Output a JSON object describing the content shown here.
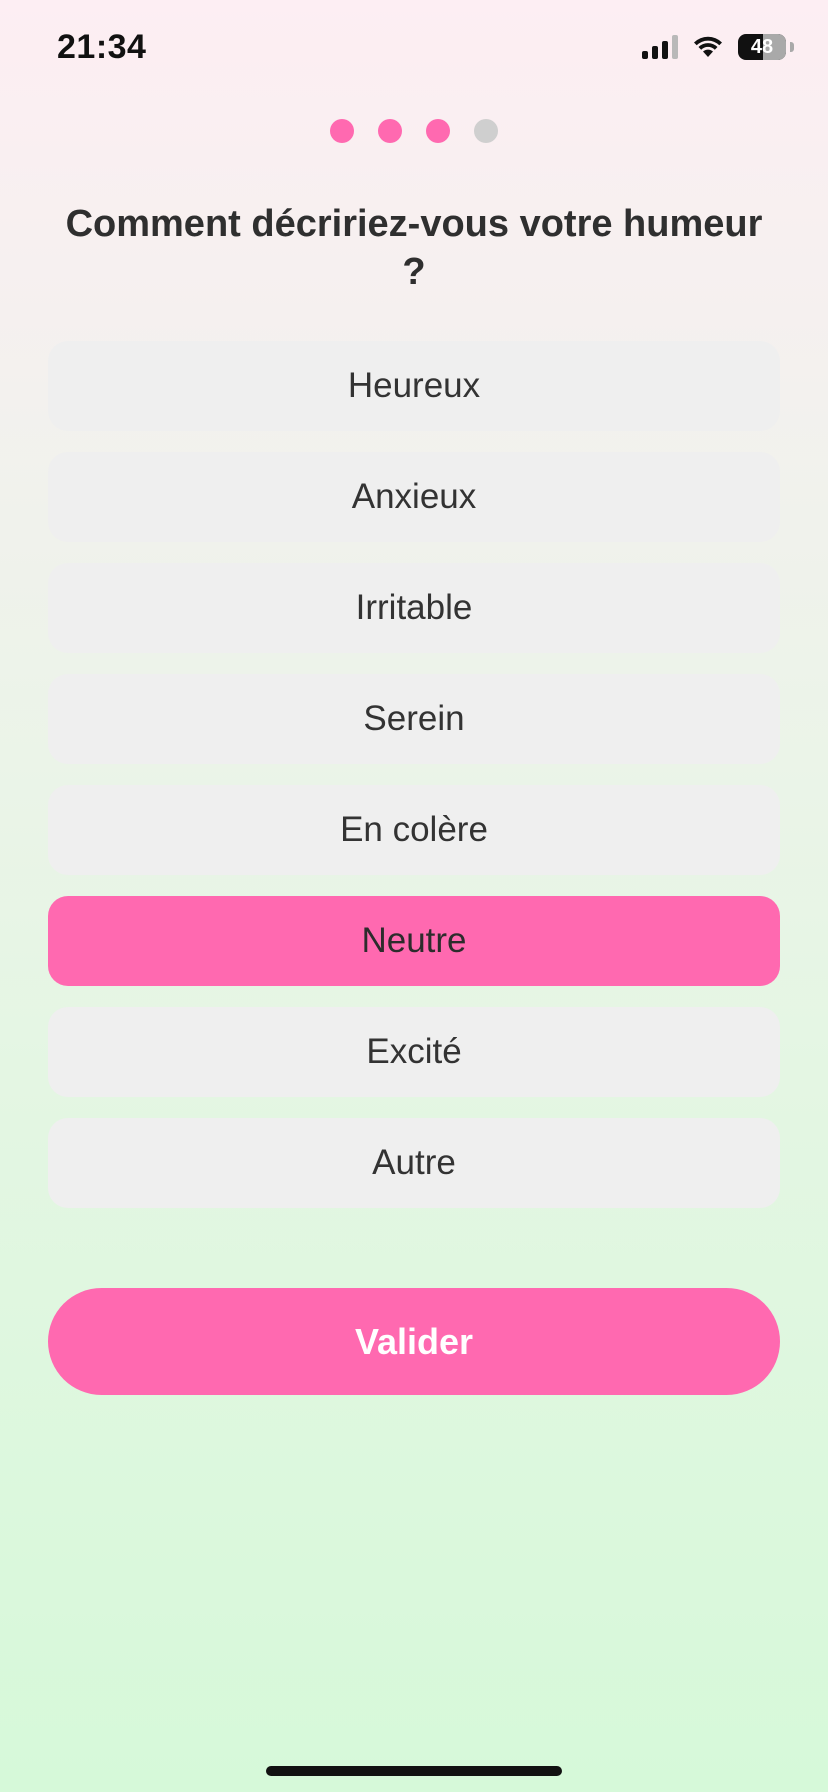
{
  "status_bar": {
    "time": "21:34",
    "battery_percent": "48",
    "battery_level": 0.48,
    "signal_bars_active": 3,
    "signal_bars_total": 4,
    "icons": [
      "cellular-signal-icon",
      "wifi-icon",
      "battery-icon"
    ]
  },
  "progress": {
    "current_step": 3,
    "total_steps": 4,
    "active_color": "#ff69b0",
    "inactive_color": "#cfcfcf"
  },
  "question": {
    "title": "Comment décririez-vous votre humeur ?"
  },
  "options": [
    {
      "label": "Heureux",
      "selected": false
    },
    {
      "label": "Anxieux",
      "selected": false
    },
    {
      "label": "Irritable",
      "selected": false
    },
    {
      "label": "Serein",
      "selected": false
    },
    {
      "label": "En colère",
      "selected": false
    },
    {
      "label": "Neutre",
      "selected": true
    },
    {
      "label": "Excité",
      "selected": false
    },
    {
      "label": "Autre",
      "selected": false
    }
  ],
  "actions": {
    "validate_label": "Valider"
  },
  "colors": {
    "accent": "#ff69b0",
    "option_background": "#efefef",
    "text": "#2f2f2f",
    "background_top": "#fdeef3",
    "background_bottom": "#d6f9d9"
  }
}
